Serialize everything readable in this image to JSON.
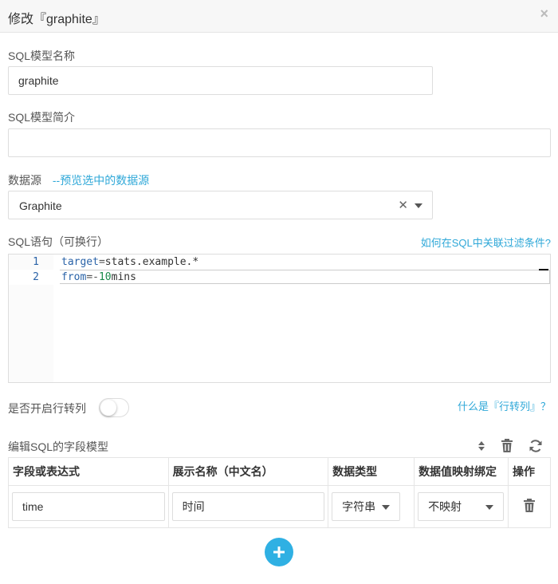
{
  "dialog": {
    "title": "修改『graphite』",
    "close_icon": "×"
  },
  "model_name": {
    "label": "SQL模型名称",
    "value": "graphite"
  },
  "model_desc": {
    "label": "SQL模型简介",
    "value": ""
  },
  "datasource": {
    "label": "数据源",
    "preview_link": "--预览选中的数据源",
    "selected": "Graphite",
    "clear_icon": "✕"
  },
  "sql": {
    "label": "SQL语句（可换行）",
    "help_link": "如何在SQL中关联过滤条件?",
    "lines": [
      {
        "num": "1",
        "kw": "target",
        "op": "=",
        "rest": "stats.example.*"
      },
      {
        "num": "2",
        "kw": "from",
        "op": "=-",
        "numlit": "10",
        "rest": "mins"
      }
    ]
  },
  "row_to_col": {
    "label": "是否开启行转列",
    "help_link": "什么是『行转列』？",
    "enabled": false
  },
  "fields": {
    "label": "编辑SQL的字段模型",
    "columns": [
      "字段或表达式",
      "展示名称（中文名）",
      "数据类型",
      "数据值映射绑定",
      "操作"
    ],
    "rows": [
      {
        "expr": "time",
        "display_name": "时间",
        "data_type": "字符串",
        "mapping": "不映射"
      }
    ]
  },
  "icons": {
    "sort": "sort-icon",
    "trash": "trash-icon",
    "refresh": "refresh-icon",
    "add": "plus-icon"
  },
  "colors": {
    "accent": "#2fa8d8",
    "add_button": "#2fb0e3"
  }
}
